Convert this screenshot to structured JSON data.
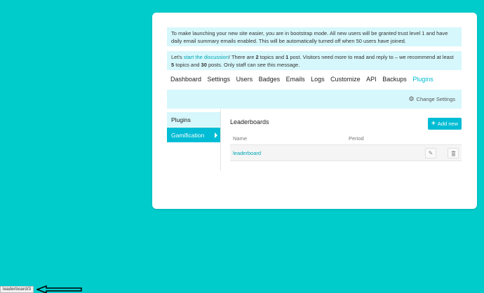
{
  "alerts": {
    "bootstrap_text": "To make launching your new site easier, you are in bootstrap mode. All new users will be granted trust level 1 and have daily email summary emails enabled. This will be automatically turned off when 50 users have joined.",
    "discussion_prefix": "Let's ",
    "discussion_link": "start the discussion",
    "discussion_mid1": "! There are ",
    "topics_count": "2",
    "discussion_mid2": " topics and ",
    "posts_count": "1",
    "discussion_mid3": " post. Visitors need more to read and reply to – we recommend at least ",
    "rec_topics": "5",
    "discussion_mid4": " topics and ",
    "rec_posts": "30",
    "discussion_end": " posts. Only staff can see this message."
  },
  "nav": {
    "items": [
      "Dashboard",
      "Settings",
      "Users",
      "Badges",
      "Emails",
      "Logs",
      "Customize",
      "API",
      "Backups",
      "Plugins"
    ],
    "active": "Plugins"
  },
  "settings_bar": {
    "change_settings_label": "Change Settings",
    "icon": "gear-icon"
  },
  "sidebar": {
    "items": [
      {
        "label": "Plugins"
      },
      {
        "label": "Gamification"
      }
    ]
  },
  "main": {
    "title": "Leaderboards",
    "add_label": "Add new",
    "columns": [
      "Name",
      "Period"
    ],
    "rows": [
      {
        "name": "leaderboard",
        "period": ""
      }
    ]
  },
  "status_bar": {
    "url": "leaderboard/3"
  },
  "colors": {
    "background": "#00cccc",
    "accent": "#00bcd4",
    "alert_bg": "#d6f7fb"
  }
}
